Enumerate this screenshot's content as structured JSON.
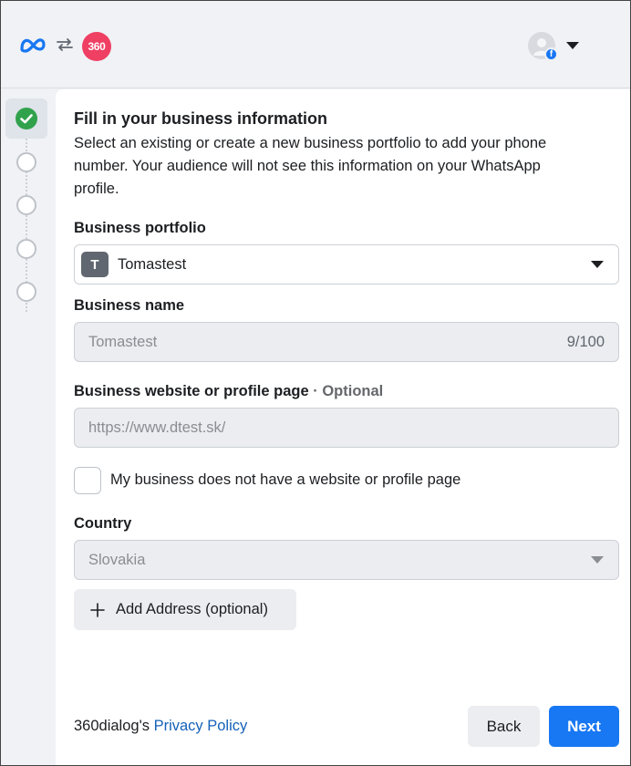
{
  "header": {
    "meta_logo_icon": "meta-infinity-icon",
    "swap_icon": "swap-arrows-icon",
    "partner_logo_text": "360",
    "account_badge": "f"
  },
  "stepper": {
    "steps": [
      {
        "state": "completed",
        "icon": "check-circle-icon"
      },
      {
        "state": "pending",
        "icon": "empty-circle-icon"
      },
      {
        "state": "pending",
        "icon": "empty-circle-icon"
      },
      {
        "state": "pending",
        "icon": "empty-circle-icon"
      },
      {
        "state": "pending",
        "icon": "empty-circle-icon"
      }
    ]
  },
  "form": {
    "title": "Fill in your business information",
    "description": "Select an existing or create a new business portfolio to add your phone number. Your audience will not see this information on your WhatsApp profile.",
    "portfolio": {
      "label": "Business portfolio",
      "avatar_letter": "T",
      "value": "Tomastest"
    },
    "business_name": {
      "label": "Business name",
      "value": "Tomastest",
      "counter": "9/100"
    },
    "website": {
      "label": "Business website or profile page",
      "optional": "· Optional",
      "value": "https://www.dtest.sk/"
    },
    "no_website_checkbox": {
      "label": "My business does not have a website or profile page",
      "checked": false
    },
    "country": {
      "label": "Country",
      "value": "Slovakia"
    },
    "add_address_label": "Add Address (optional)"
  },
  "footer": {
    "privacy_prefix": "360dialog's",
    "privacy_link": "Privacy Policy",
    "back_label": "Back",
    "next_label": "Next"
  },
  "colors": {
    "primary": "#1877f2",
    "success": "#31a24c",
    "brand_360": "#ef3f63",
    "link": "#1461b8"
  }
}
